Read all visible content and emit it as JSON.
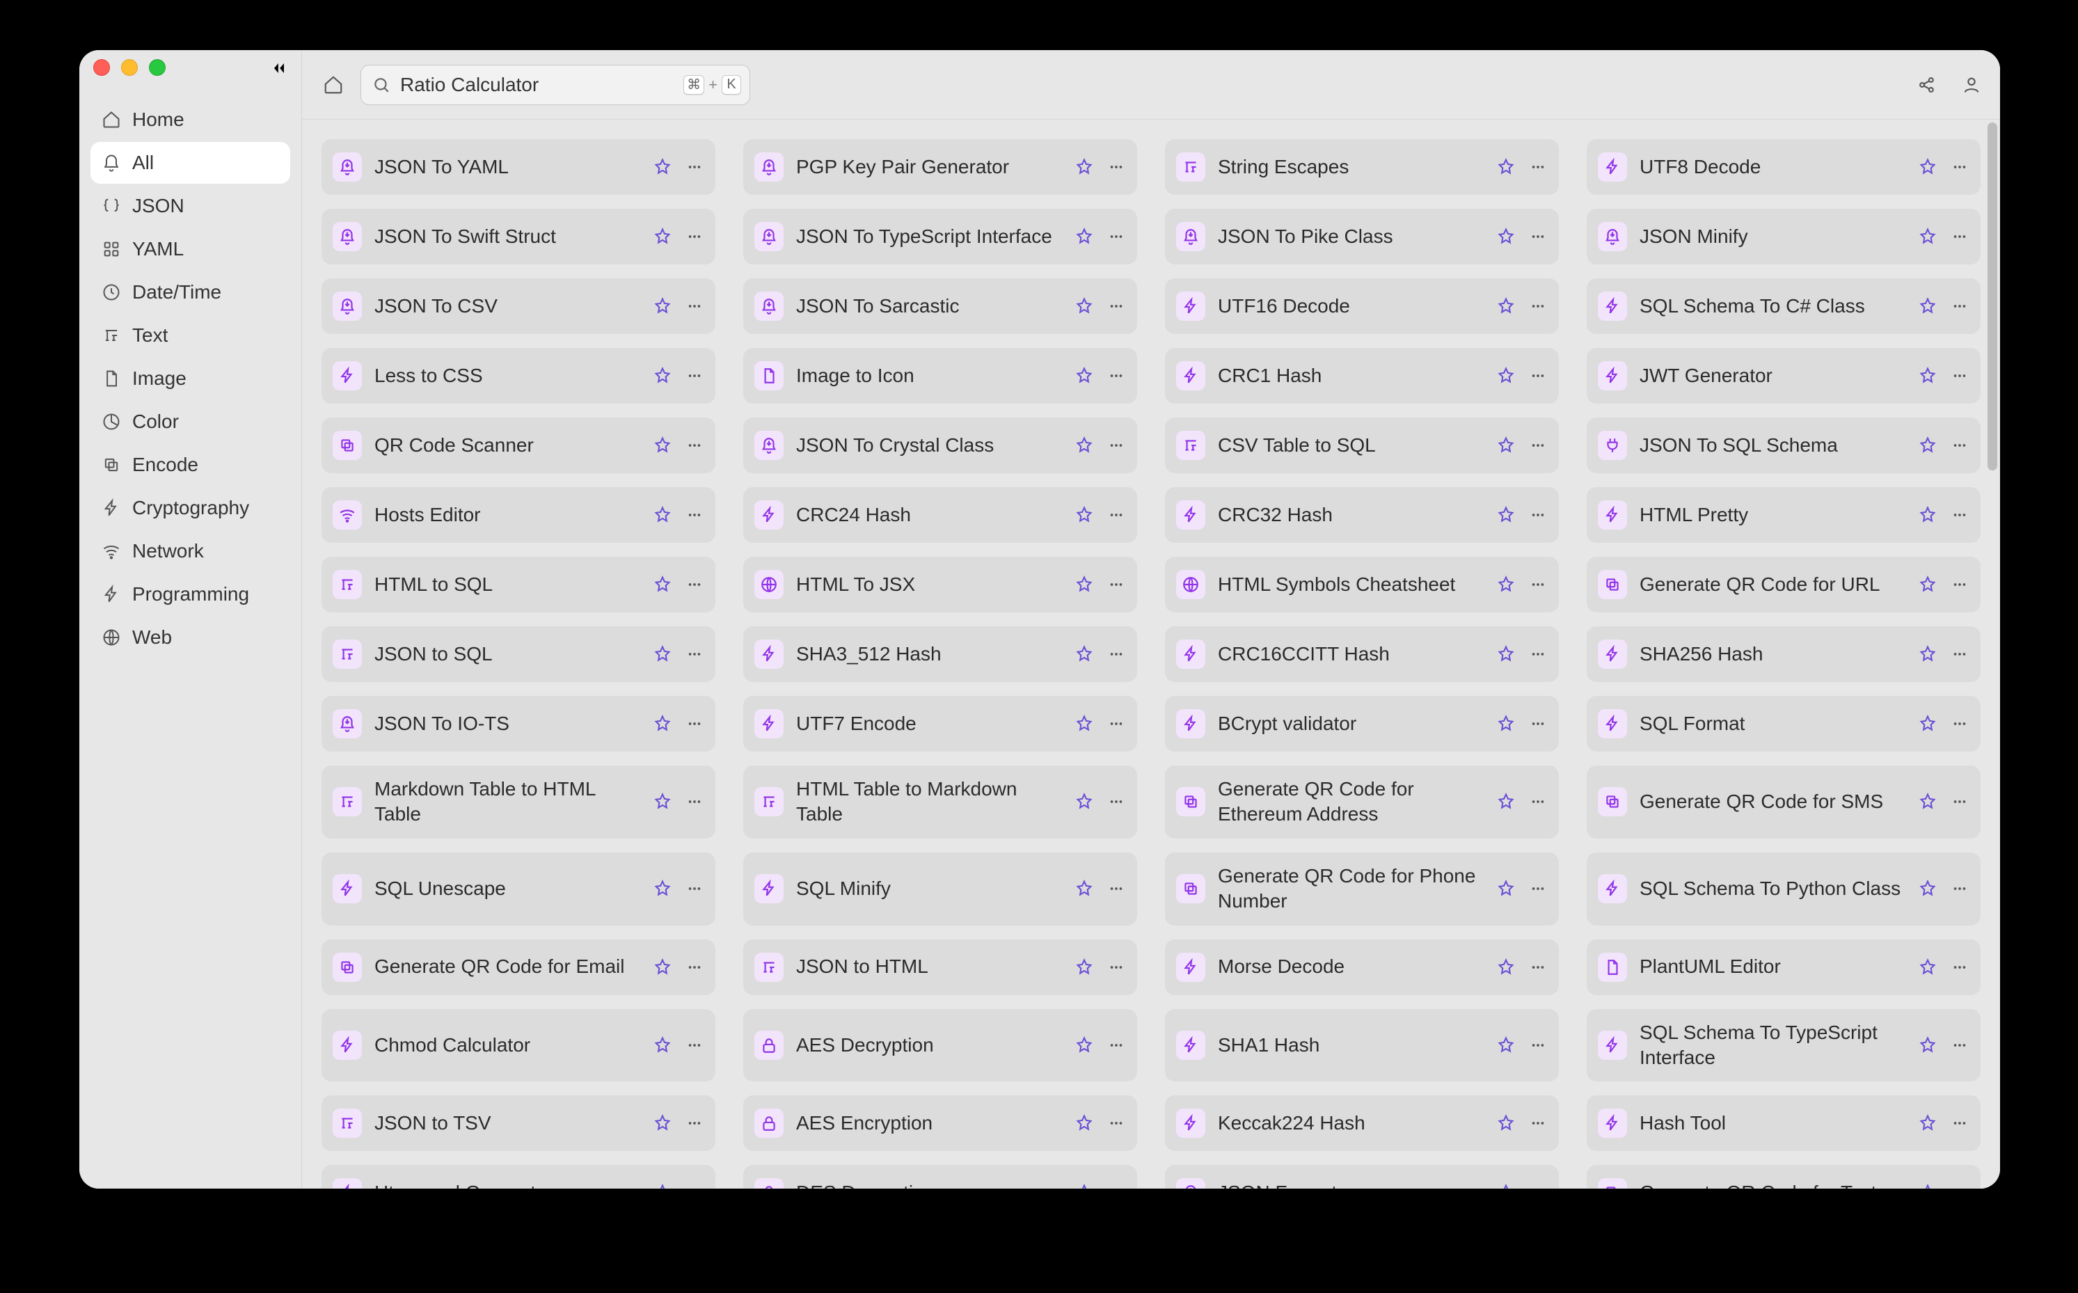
{
  "search": {
    "value": "Ratio Calculator",
    "shortcut": {
      "mod": "⌘",
      "plus": "+",
      "key": "K"
    }
  },
  "sidebar": {
    "items": [
      {
        "label": "Home",
        "active": false,
        "icon": "home"
      },
      {
        "label": "All",
        "active": true,
        "icon": "bell"
      },
      {
        "label": "JSON",
        "active": false,
        "icon": "braces"
      },
      {
        "label": "YAML",
        "active": false,
        "icon": "grid"
      },
      {
        "label": "Date/Time",
        "active": false,
        "icon": "clock"
      },
      {
        "label": "Text",
        "active": false,
        "icon": "text"
      },
      {
        "label": "Image",
        "active": false,
        "icon": "file"
      },
      {
        "label": "Color",
        "active": false,
        "icon": "pie"
      },
      {
        "label": "Encode",
        "active": false,
        "icon": "stack"
      },
      {
        "label": "Cryptography",
        "active": false,
        "icon": "bolt"
      },
      {
        "label": "Network",
        "active": false,
        "icon": "wifi"
      },
      {
        "label": "Programming",
        "active": false,
        "icon": "bolt"
      },
      {
        "label": "Web",
        "active": false,
        "icon": "globe"
      }
    ]
  },
  "tools": [
    {
      "label": "JSON To YAML",
      "icon": "bell-down"
    },
    {
      "label": "PGP Key Pair Generator",
      "icon": "bell-down"
    },
    {
      "label": "String Escapes",
      "icon": "text"
    },
    {
      "label": "UTF8 Decode",
      "icon": "bolt"
    },
    {
      "label": "JSON To Swift Struct",
      "icon": "bell-down"
    },
    {
      "label": "JSON To TypeScript Interface",
      "icon": "bell-down"
    },
    {
      "label": "JSON To Pike Class",
      "icon": "bell-down"
    },
    {
      "label": "JSON Minify",
      "icon": "bell-down"
    },
    {
      "label": "JSON To CSV",
      "icon": "bell-down"
    },
    {
      "label": "JSON To Sarcastic",
      "icon": "bell-down"
    },
    {
      "label": "UTF16 Decode",
      "icon": "bolt"
    },
    {
      "label": "SQL Schema To C# Class",
      "icon": "bolt"
    },
    {
      "label": "Less to CSS",
      "icon": "bolt"
    },
    {
      "label": "Image to Icon",
      "icon": "file"
    },
    {
      "label": "CRC1 Hash",
      "icon": "bolt"
    },
    {
      "label": "JWT Generator",
      "icon": "bolt"
    },
    {
      "label": "QR Code Scanner",
      "icon": "stack"
    },
    {
      "label": "JSON To Crystal Class",
      "icon": "bell-down"
    },
    {
      "label": "CSV Table to SQL",
      "icon": "text"
    },
    {
      "label": "JSON To SQL Schema",
      "icon": "plug"
    },
    {
      "label": "Hosts Editor",
      "icon": "wifi"
    },
    {
      "label": "CRC24 Hash",
      "icon": "bolt"
    },
    {
      "label": "CRC32 Hash",
      "icon": "bolt"
    },
    {
      "label": "HTML Pretty",
      "icon": "bolt"
    },
    {
      "label": "HTML to SQL",
      "icon": "text"
    },
    {
      "label": "HTML To JSX",
      "icon": "globe"
    },
    {
      "label": "HTML Symbols Cheatsheet",
      "icon": "globe"
    },
    {
      "label": "Generate QR Code for URL",
      "icon": "stack"
    },
    {
      "label": "JSON to SQL",
      "icon": "text"
    },
    {
      "label": "SHA3_512 Hash",
      "icon": "bolt"
    },
    {
      "label": "CRC16CCITT Hash",
      "icon": "bolt"
    },
    {
      "label": "SHA256 Hash",
      "icon": "bolt"
    },
    {
      "label": "JSON To IO-TS",
      "icon": "bell-down"
    },
    {
      "label": "UTF7 Encode",
      "icon": "bolt"
    },
    {
      "label": "BCrypt validator",
      "icon": "bolt"
    },
    {
      "label": "SQL Format",
      "icon": "bolt"
    },
    {
      "label": "Markdown Table to HTML Table",
      "icon": "text"
    },
    {
      "label": "HTML Table to Markdown Table",
      "icon": "text"
    },
    {
      "label": "Generate QR Code for Ethereum Address",
      "icon": "stack"
    },
    {
      "label": "Generate QR Code for SMS",
      "icon": "stack"
    },
    {
      "label": "SQL Unescape",
      "icon": "bolt"
    },
    {
      "label": "SQL Minify",
      "icon": "bolt"
    },
    {
      "label": "Generate QR Code for Phone Number",
      "icon": "stack"
    },
    {
      "label": "SQL Schema To Python Class",
      "icon": "bolt"
    },
    {
      "label": "Generate QR Code for Email",
      "icon": "stack"
    },
    {
      "label": "JSON to HTML",
      "icon": "text"
    },
    {
      "label": "Morse Decode",
      "icon": "bolt"
    },
    {
      "label": "PlantUML Editor",
      "icon": "file"
    },
    {
      "label": "Chmod Calculator",
      "icon": "bolt"
    },
    {
      "label": "AES Decryption",
      "icon": "lock"
    },
    {
      "label": "SHA1 Hash",
      "icon": "bolt"
    },
    {
      "label": "SQL Schema To TypeScript Interface",
      "icon": "bolt"
    },
    {
      "label": "JSON to TSV",
      "icon": "text"
    },
    {
      "label": "AES Encryption",
      "icon": "lock"
    },
    {
      "label": "Keccak224 Hash",
      "icon": "bolt"
    },
    {
      "label": "Hash Tool",
      "icon": "bolt"
    },
    {
      "label": "Htpasswd Generator",
      "icon": "bolt"
    },
    {
      "label": "DES Decryption",
      "icon": "lock"
    },
    {
      "label": "JSON Format",
      "icon": "bell-down"
    },
    {
      "label": "Generate QR Code for Text",
      "icon": "stack"
    }
  ]
}
